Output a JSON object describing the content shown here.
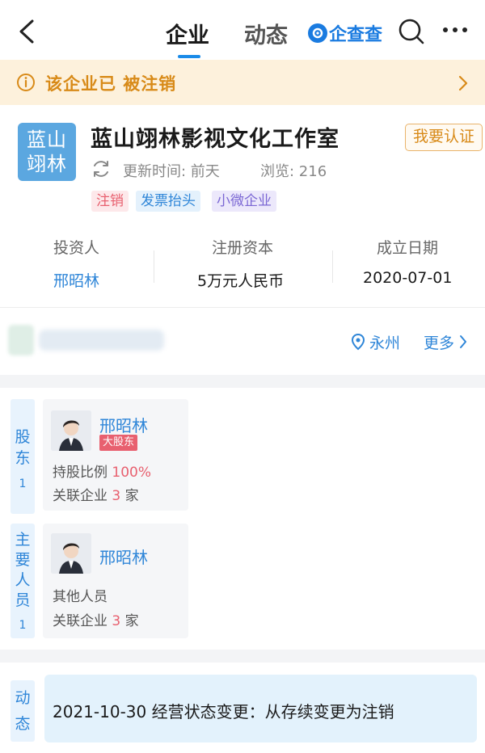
{
  "nav": {
    "tab_company": "企业",
    "tab_feed": "动态",
    "brand": "企查查"
  },
  "banner": {
    "text": "该企业已 被注销"
  },
  "company": {
    "logo_line1": "蓝山",
    "logo_line2": "翊林",
    "name": "蓝山翊林影视文化工作室",
    "verify_label": "我要认证",
    "update_time": "更新时间: 前天",
    "views": "浏览: 216",
    "tags": [
      "注销",
      "发票抬头",
      "小微企业"
    ]
  },
  "keyinfo": [
    {
      "label": "投资人",
      "value": "邢昭林"
    },
    {
      "label": "注册资本",
      "value": "5万元人民币"
    },
    {
      "label": "成立日期",
      "value": "2020-07-01"
    }
  ],
  "address": {
    "city": "永州",
    "more": "更多"
  },
  "shareholders": {
    "label_chars": [
      "股",
      "东"
    ],
    "count": "1",
    "person": {
      "name": "邢昭林",
      "badge": "大股东",
      "ratio_label": "持股比例",
      "ratio_value": "100%",
      "related_label": "关联企业",
      "related_count": "3",
      "related_unit": "家"
    }
  },
  "staff": {
    "label_chars": [
      "主",
      "要",
      "人",
      "员"
    ],
    "count": "1",
    "person": {
      "name": "邢昭林",
      "role": "其他人员",
      "related_label": "关联企业",
      "related_count": "3",
      "related_unit": "家"
    }
  },
  "feed": {
    "label_chars": [
      "动",
      "态"
    ],
    "text": "2021-10-30 经营状态变更：从存续变更为注销"
  },
  "colors": {
    "accent": "#2f86d8",
    "warning": "#d88a18",
    "danger": "#e8606f"
  }
}
